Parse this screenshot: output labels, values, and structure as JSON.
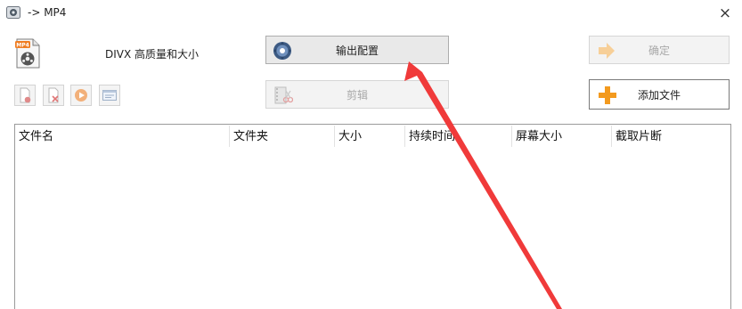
{
  "window": {
    "title": "-> MP4",
    "close_glyph": "×"
  },
  "output": {
    "format_label": "DIVX 高质量和大小"
  },
  "buttons": {
    "output_config": "输出配置",
    "ok": "确定",
    "clip": "剪辑",
    "add_file": "添加文件"
  },
  "table": {
    "columns": [
      "文件名",
      "文件夹",
      "大小",
      "持续时间",
      "屏幕大小",
      "截取片断"
    ]
  },
  "colors": {
    "annotation_arrow": "#f03a3a",
    "add_plus": "#f39a1e",
    "button_face": "#e9e9e9"
  }
}
